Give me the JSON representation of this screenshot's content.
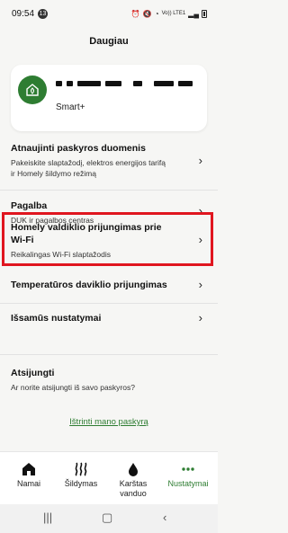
{
  "status_bar": {
    "time": "09:54",
    "notification_count": "13",
    "network": "Vo)) LTE1"
  },
  "page": {
    "title": "Daugiau"
  },
  "account": {
    "plan": "Smart+"
  },
  "menu": [
    {
      "title": "Atnaujinti paskyros duomenis",
      "subtitle_line1": "Pakeiskite slaptažodį, elektros energijos tarifą",
      "subtitle_line2": "ir Homely šildymo režimą"
    },
    {
      "title": "Pagalba",
      "subtitle_line1": "DUK ir pagalbos centras"
    },
    {
      "title_line1": "Homely valdiklio prijungimas prie",
      "title_line2": "Wi-Fi",
      "subtitle_line1": "Reikalingas Wi-Fi slaptažodis"
    },
    {
      "title": "Temperatūros daviklio prijungimas"
    },
    {
      "title": "Išsamūs nustatymai"
    },
    {
      "title": "Atsijungti",
      "subtitle_line1": "Ar norite atsijungti iš savo paskyros?"
    }
  ],
  "delete_account": "Ištrinti mano paskyrą",
  "bottom_nav": [
    {
      "label": "Namai",
      "icon": "home-icon"
    },
    {
      "label": "Šildymas",
      "icon": "heat-waves-icon"
    },
    {
      "label_line1": "Karštas",
      "label_line2": "vanduo",
      "icon": "water-drop-icon"
    },
    {
      "label": "Nustatymai",
      "icon": "more-dots-icon",
      "active": true
    }
  ],
  "colors": {
    "accent": "#2e7d32",
    "highlight": "#e0161f"
  }
}
